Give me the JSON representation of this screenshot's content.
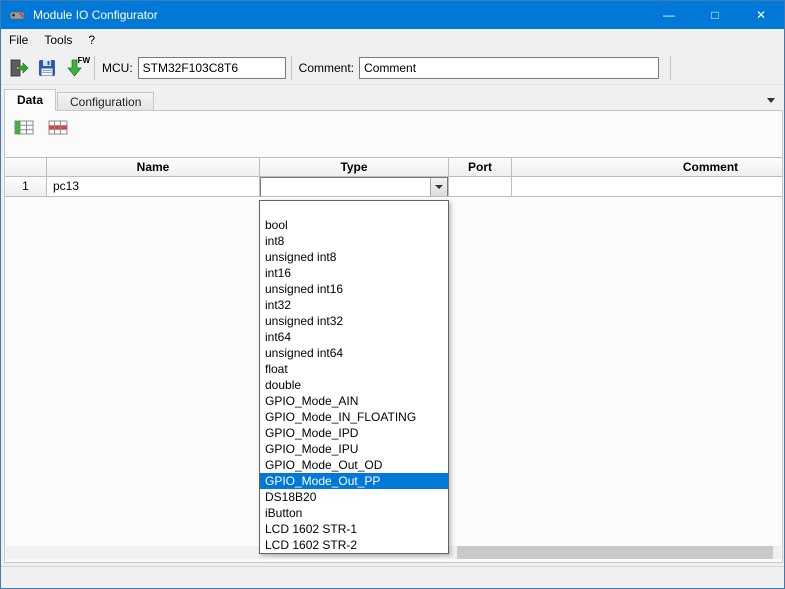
{
  "window": {
    "title": "Module IO Configurator",
    "minimize": "—",
    "maximize": "□",
    "close": "✕"
  },
  "menu": {
    "file": "File",
    "tools": "Tools",
    "help": "?"
  },
  "toolbar": {
    "fw_badge": "FW",
    "mcu_label": "MCU:",
    "mcu_value": "STM32F103C8T6",
    "comment_label": "Comment:",
    "comment_value": "Comment"
  },
  "tabs": {
    "data": "Data",
    "configuration": "Configuration"
  },
  "grid": {
    "headers": {
      "name": "Name",
      "type": "Type",
      "port": "Port",
      "comment": "Comment"
    },
    "rows": [
      {
        "num": "1",
        "name": "pc13",
        "type": "",
        "port": "",
        "comment": ""
      }
    ]
  },
  "dropdown": {
    "items": [
      "",
      "bool",
      "int8",
      "unsigned int8",
      "int16",
      "unsigned int16",
      "int32",
      "unsigned int32",
      "int64",
      "unsigned int64",
      "float",
      "double",
      "GPIO_Mode_AIN",
      "GPIO_Mode_IN_FLOATING",
      "GPIO_Mode_IPD",
      "GPIO_Mode_IPU",
      "GPIO_Mode_Out_OD",
      "GPIO_Mode_Out_PP",
      "DS18B20",
      "iButton",
      "LCD 1602 STR-1",
      "LCD 1602 STR-2"
    ],
    "selected": "GPIO_Mode_Out_PP"
  },
  "colors": {
    "titlebar": "#0078d7",
    "selection": "#0078d7"
  }
}
